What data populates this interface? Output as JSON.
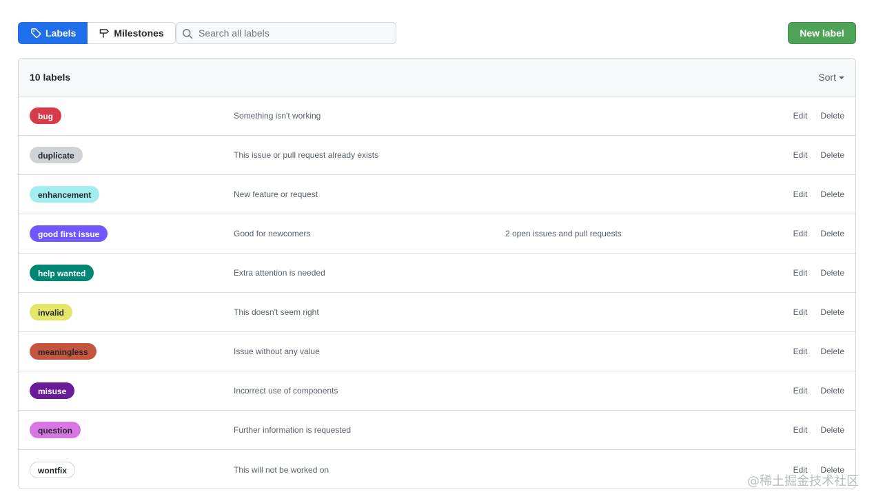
{
  "toolbar": {
    "tabs": [
      {
        "label": "Labels",
        "icon": "tag-icon",
        "selected": true
      },
      {
        "label": "Milestones",
        "icon": "milestone-icon",
        "selected": false
      }
    ],
    "search_placeholder": "Search all labels",
    "new_label": "New label"
  },
  "list": {
    "count_text": "10 labels",
    "sort_label": "Sort",
    "edit_label": "Edit",
    "delete_label": "Delete",
    "labels": [
      {
        "name": "bug",
        "description": "Something isn't working",
        "issues": "",
        "color": "#d73a4a",
        "text_color": "#ffffff"
      },
      {
        "name": "duplicate",
        "description": "This issue or pull request already exists",
        "issues": "",
        "color": "#cfd3d7",
        "text_color": "#24292f"
      },
      {
        "name": "enhancement",
        "description": "New feature or request",
        "issues": "",
        "color": "#a2eeef",
        "text_color": "#24292f"
      },
      {
        "name": "good first issue",
        "description": "Good for newcomers",
        "issues": "2 open issues and pull requests",
        "color": "#7057ff",
        "text_color": "#ffffff"
      },
      {
        "name": "help wanted",
        "description": "Extra attention is needed",
        "issues": "",
        "color": "#008672",
        "text_color": "#ffffff"
      },
      {
        "name": "invalid",
        "description": "This doesn't seem right",
        "issues": "",
        "color": "#e4e669",
        "text_color": "#24292f"
      },
      {
        "name": "meaningless",
        "description": "Issue without any value",
        "issues": "",
        "color": "#c5553f",
        "text_color": "#24292f"
      },
      {
        "name": "misuse",
        "description": "Incorrect use of components",
        "issues": "",
        "color": "#6a1b9a",
        "text_color": "#ffffff"
      },
      {
        "name": "question",
        "description": "Further information is requested",
        "issues": "",
        "color": "#d876e3",
        "text_color": "#24292f"
      },
      {
        "name": "wontfix",
        "description": "This will not be worked on",
        "issues": "",
        "color": "#ffffff",
        "text_color": "#24292f"
      }
    ]
  },
  "watermark": "@稀土掘金技术社区"
}
